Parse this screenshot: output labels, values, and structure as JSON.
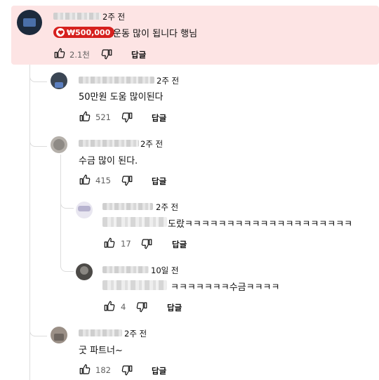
{
  "comments": [
    {
      "id": "c1",
      "time": "2주 전",
      "donation": "₩500,000",
      "text": "운동 많이 됩니다 행님",
      "likes": "2.1천",
      "reply": "답글"
    },
    {
      "id": "c2",
      "time": "2주 전",
      "text": "50만원 도움 많이된다",
      "likes": "521",
      "reply": "답글"
    },
    {
      "id": "c3",
      "time": "2주 전",
      "text": "수금 많이 된다.",
      "likes": "415",
      "reply": "답글"
    },
    {
      "id": "c4",
      "time": "2주 전",
      "text": "도랐ㅋㅋㅋㅋㅋㅋㅋㅋㅋㅋㅋㅋㅋㅋㅋㅋㅋㅋㅋㅋ",
      "likes": "17",
      "reply": "답글"
    },
    {
      "id": "c5",
      "time": "10일 전",
      "text": "ㅋㅋㅋㅋㅋㅋㅋ수금ㅋㅋㅋㅋ",
      "likes": "4",
      "reply": "답글"
    },
    {
      "id": "c6",
      "time": "2주 전",
      "text": "굿 파트너~",
      "likes": "182",
      "reply": "답글"
    }
  ],
  "icons": {
    "like": "thumb-up-icon",
    "dislike": "thumb-down-icon",
    "donation": "heart-donation-icon"
  },
  "colors": {
    "highlight": "#fde4e4",
    "donation": "#d6201e"
  }
}
